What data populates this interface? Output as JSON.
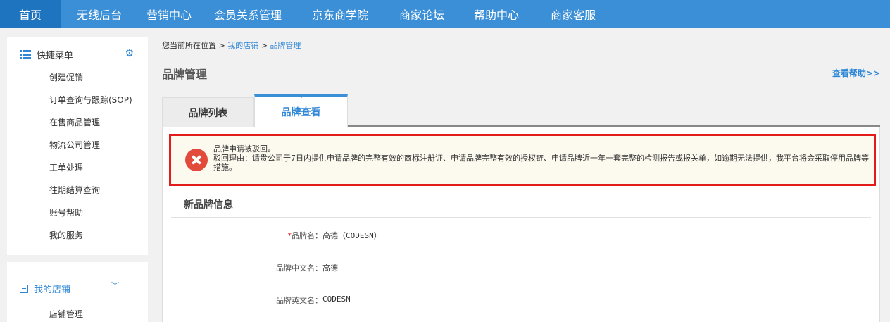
{
  "topnav": {
    "items": [
      {
        "label": "首页"
      },
      {
        "label": "无线后台"
      },
      {
        "label": "营销中心"
      },
      {
        "label": "会员关系管理"
      },
      {
        "label": "京东商学院"
      },
      {
        "label": "商家论坛"
      },
      {
        "label": "帮助中心"
      },
      {
        "label": "商家客服"
      }
    ],
    "active_index": 0
  },
  "sidebar": {
    "quick_menu": {
      "title": "快捷菜单",
      "icon": "list-icon",
      "settings_icon": "gear-icon",
      "items": [
        {
          "label": "创建促销"
        },
        {
          "label": "订单查询与跟踪(SOP)"
        },
        {
          "label": "在售商品管理"
        },
        {
          "label": "物流公司管理"
        },
        {
          "label": "工单处理"
        },
        {
          "label": "往期结算查询"
        },
        {
          "label": "账号帮助"
        },
        {
          "label": "我的服务"
        }
      ]
    },
    "my_shop": {
      "title": "我的店铺",
      "items": [
        {
          "label": "店铺管理"
        }
      ]
    }
  },
  "breadcrumb": {
    "prefix": "您当前所在位置 > ",
    "level1": "我的店铺",
    "sep": " > ",
    "level2": "品牌管理"
  },
  "page": {
    "title": "品牌管理",
    "help_link": "查看帮助>>"
  },
  "tabs": [
    {
      "label": "品牌列表",
      "active": false
    },
    {
      "label": "品牌查看",
      "active": true
    }
  ],
  "alert": {
    "line1": "品牌申请被驳回。",
    "line2": "驳回理由：请贵公司于7日内提供申请品牌的完整有效的商标注册证、申请品牌完整有效的授权链、申请品牌近一年一套完整的检测报告或报关单，如逾期无法提供，我平台将会采取停用品牌等措施。",
    "icon": "error-x-icon"
  },
  "section": {
    "title": "新品牌信息",
    "fields": [
      {
        "label": "品牌名：",
        "required": true,
        "value": "高德（CODESN）"
      },
      {
        "label": "品牌中文名：",
        "required": false,
        "value": "高德"
      },
      {
        "label": "品牌英文名：",
        "required": false,
        "value": "CODESN"
      }
    ]
  },
  "colors": {
    "nav_bg": "#3b8fd6",
    "nav_active": "#1f74c0",
    "link": "#2e86d6",
    "alert_border": "#e31b1b"
  }
}
